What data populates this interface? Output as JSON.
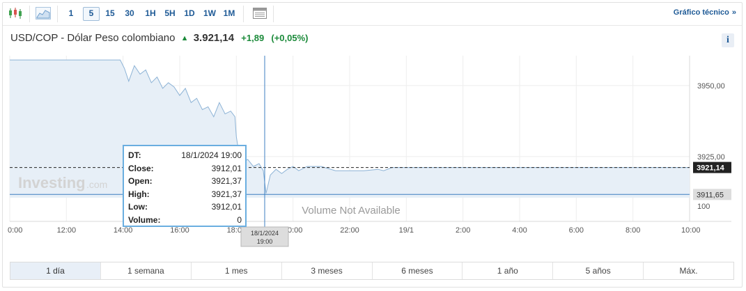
{
  "toolbar": {
    "intervals": [
      {
        "label": "1",
        "active": false
      },
      {
        "label": "5",
        "active": true
      },
      {
        "label": "15",
        "active": false
      },
      {
        "label": "30",
        "active": false
      },
      {
        "label": "1H",
        "active": false
      },
      {
        "label": "5H",
        "active": false
      },
      {
        "label": "1D",
        "active": false
      },
      {
        "label": "1W",
        "active": false
      },
      {
        "label": "1M",
        "active": false
      }
    ],
    "icons": [
      "candlestick-icon",
      "area-chart-icon",
      "table-icon"
    ],
    "tech_link": "Gráfico técnico",
    "tech_chevron": "»"
  },
  "header": {
    "symbol": "USD/COP - Dólar Peso colombiano",
    "price": "3.921,14",
    "change": "+1,89",
    "change_pct": "(+0,05%)",
    "info": "i"
  },
  "colors": {
    "up": "#1b8a3a",
    "line": "#8db3d6",
    "area": "#e7eff7",
    "crosshair": "#3d7fc1",
    "accent": "#1e5a96"
  },
  "chart_data": {
    "type": "area",
    "title": "",
    "xlabel": "",
    "ylabel": "",
    "x_ticks": [
      "0:00",
      "12:00",
      "14:00",
      "16:00",
      "18:00",
      "20:00",
      "22:00",
      "19/1",
      "2:00",
      "4:00",
      "6:00",
      "8:00",
      "10:00"
    ],
    "y_ticks": [
      "3950,00",
      "3925,00"
    ],
    "ylim": [
      3910.5,
      3960.5
    ],
    "x_hours_range": [
      10.0,
      34.0
    ],
    "series": [
      {
        "x": [
          10.0,
          13.9,
          14.05,
          14.2,
          14.4,
          14.6,
          14.8,
          15.0,
          15.2,
          15.4,
          15.6,
          15.8,
          16.0,
          16.2,
          16.4,
          16.6,
          16.8,
          17.0,
          17.2,
          17.4,
          17.6,
          17.8,
          17.95,
          18.0,
          18.1,
          18.25,
          18.4,
          18.6,
          18.8,
          18.95,
          19.05,
          19.2,
          19.4,
          19.6,
          19.8,
          20.0,
          20.2,
          20.5,
          21.0,
          21.5,
          22.0,
          22.5,
          23.0,
          23.2,
          23.5,
          24.0,
          26.0,
          28.0,
          30.0,
          32.0,
          34.0
        ],
        "values": [
          3959.0,
          3959.0,
          3956.0,
          3951.5,
          3957.0,
          3954.0,
          3955.5,
          3951.0,
          3953.0,
          3949.0,
          3951.0,
          3949.5,
          3946.5,
          3949.0,
          3944.0,
          3945.5,
          3941.5,
          3942.5,
          3939.0,
          3944.0,
          3940.0,
          3941.0,
          3939.0,
          3932.0,
          3925.5,
          3923.0,
          3924.0,
          3921.5,
          3922.5,
          3920.0,
          3912.01,
          3918.5,
          3920.5,
          3919.0,
          3920.5,
          3921.5,
          3920.0,
          3921.5,
          3921.5,
          3920.0,
          3920.0,
          3920.0,
          3920.5,
          3920.0,
          3921.14,
          3921.14,
          3921.14,
          3921.14,
          3921.14,
          3921.14,
          3921.14
        ]
      }
    ],
    "last_price_label": "3921,14",
    "hover_price_label": "3911,65",
    "hover_time_label": [
      "18/1/2024",
      "19:00"
    ],
    "volume_text": "Volume Not Available",
    "volume_axis_label": "100",
    "grid": true,
    "watermark_brand": "Investing",
    "watermark_suffix": ".com",
    "tooltip": [
      {
        "key": "DT:",
        "value": "18/1/2024 19:00"
      },
      {
        "key": "Close:",
        "value": "3912,01"
      },
      {
        "key": "Open:",
        "value": "3921,37"
      },
      {
        "key": "High:",
        "value": "3921,37"
      },
      {
        "key": "Low:",
        "value": "3912,01"
      },
      {
        "key": "Volume:",
        "value": "0"
      }
    ]
  },
  "ranges": [
    {
      "label": "1 día",
      "active": true
    },
    {
      "label": "1 semana",
      "active": false
    },
    {
      "label": "1 mes",
      "active": false
    },
    {
      "label": "3 meses",
      "active": false
    },
    {
      "label": "6 meses",
      "active": false
    },
    {
      "label": "1 año",
      "active": false
    },
    {
      "label": "5 años",
      "active": false
    },
    {
      "label": "Máx.",
      "active": false
    }
  ]
}
